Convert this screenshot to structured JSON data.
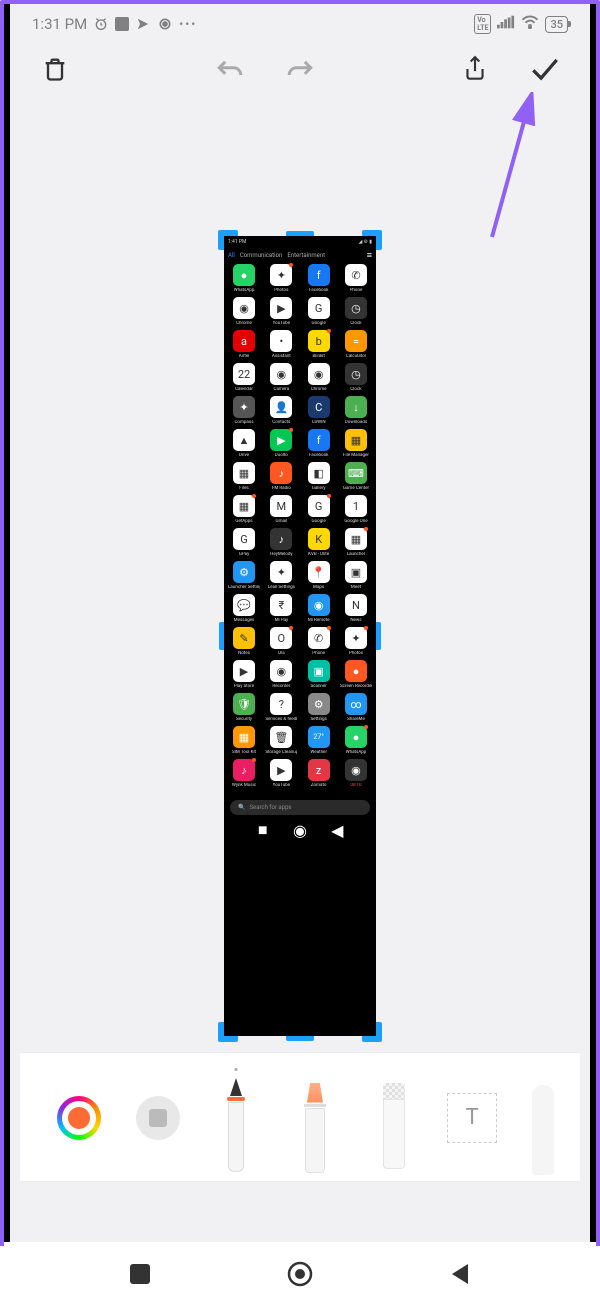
{
  "status": {
    "time": "1:31 PM",
    "battery": "35"
  },
  "toolbar": {
    "delete": "",
    "undo": "",
    "redo": "",
    "share": "",
    "confirm": ""
  },
  "phone": {
    "time": "1:41 PM",
    "tabs": [
      {
        "label": "All",
        "active": true
      },
      {
        "label": "Communication",
        "active": false
      },
      {
        "label": "Entertainment",
        "active": false
      }
    ],
    "search_placeholder": "Search for apps",
    "apps": [
      [
        {
          "n": "WhatsApp",
          "c": "#25d366",
          "i": "●",
          "d": false
        },
        {
          "n": "Photos",
          "c": "#fff",
          "i": "✦",
          "d": true
        },
        {
          "n": "Facebook",
          "c": "#1877f2",
          "i": "f",
          "d": false
        },
        {
          "n": "Phone",
          "c": "#fff",
          "i": "✆",
          "d": false
        }
      ],
      [
        {
          "n": "Chrome",
          "c": "#fff",
          "i": "◉",
          "d": false
        },
        {
          "n": "YouTube",
          "c": "#fff",
          "i": "▶",
          "d": false
        },
        {
          "n": "Google",
          "c": "#fff",
          "i": "G",
          "d": false
        },
        {
          "n": "Clock",
          "c": "#333",
          "i": "◷",
          "d": false
        }
      ],
      [
        {
          "n": "Airtel",
          "c": "#e40000",
          "i": "a",
          "d": false
        },
        {
          "n": "Assistant",
          "c": "#fff",
          "i": "•",
          "d": false
        },
        {
          "n": "Blinkit",
          "c": "#ffd800",
          "i": "b",
          "d": true
        },
        {
          "n": "Calculator",
          "c": "#ff9800",
          "i": "=",
          "d": false
        }
      ],
      [
        {
          "n": "Calendar",
          "c": "#fff",
          "i": "22",
          "d": false
        },
        {
          "n": "Camera",
          "c": "#fff",
          "i": "◉",
          "d": false
        },
        {
          "n": "Chrome",
          "c": "#fff",
          "i": "◉",
          "d": false
        },
        {
          "n": "Clock",
          "c": "#333",
          "i": "◷",
          "d": false
        }
      ],
      [
        {
          "n": "Compass",
          "c": "#555",
          "i": "✦",
          "d": false
        },
        {
          "n": "Contacts",
          "c": "#fff",
          "i": "👤",
          "d": false
        },
        {
          "n": "CoWIN",
          "c": "#1a3a6e",
          "i": "C",
          "d": false
        },
        {
          "n": "Downloads",
          "c": "#4caf50",
          "i": "↓",
          "d": false
        }
      ],
      [
        {
          "n": "Drive",
          "c": "#fff",
          "i": "▲",
          "d": false
        },
        {
          "n": "Duolto",
          "c": "#00c853",
          "i": "▶",
          "d": true
        },
        {
          "n": "Facebook",
          "c": "#1877f2",
          "i": "f",
          "d": false
        },
        {
          "n": "File Manager",
          "c": "#ffc107",
          "i": "▦",
          "d": false
        }
      ],
      [
        {
          "n": "Files",
          "c": "#fff",
          "i": "▦",
          "d": false
        },
        {
          "n": "FM Radio",
          "c": "#ff5722",
          "i": "♪",
          "d": false
        },
        {
          "n": "Gallery",
          "c": "#fff",
          "i": "◧",
          "d": false
        },
        {
          "n": "Game Center",
          "c": "#4caf50",
          "i": "⌨",
          "d": false
        }
      ],
      [
        {
          "n": "GetApps",
          "c": "#fff",
          "i": "▦",
          "d": true
        },
        {
          "n": "Gmail",
          "c": "#fff",
          "i": "M",
          "d": false
        },
        {
          "n": "Google",
          "c": "#fff",
          "i": "G",
          "d": true
        },
        {
          "n": "Google One",
          "c": "#fff",
          "i": "1",
          "d": false
        }
      ],
      [
        {
          "n": "GPay",
          "c": "#fff",
          "i": "G",
          "d": false
        },
        {
          "n": "HeyMelody",
          "c": "#333",
          "i": "♪",
          "d": false
        },
        {
          "n": "KVB - Dlite",
          "c": "#ffd800",
          "i": "K",
          "d": false
        },
        {
          "n": "Launcher",
          "c": "#fff",
          "i": "▦",
          "d": true
        }
      ],
      [
        {
          "n": "Launcher Settings",
          "c": "#2196f3",
          "i": "⚙",
          "d": false
        },
        {
          "n": "Lean Settings",
          "c": "#fff",
          "i": "✦",
          "d": false
        },
        {
          "n": "Maps",
          "c": "#fff",
          "i": "📍",
          "d": false
        },
        {
          "n": "Meet",
          "c": "#fff",
          "i": "▣",
          "d": false
        }
      ],
      [
        {
          "n": "Messages",
          "c": "#fff",
          "i": "💬",
          "d": false
        },
        {
          "n": "Mi Pay",
          "c": "#fff",
          "i": "₹",
          "d": false
        },
        {
          "n": "Mi Remote",
          "c": "#2196f3",
          "i": "◉",
          "d": false
        },
        {
          "n": "News",
          "c": "#fff",
          "i": "N",
          "d": false
        }
      ],
      [
        {
          "n": "Notes",
          "c": "#ffc107",
          "i": "✎",
          "d": false
        },
        {
          "n": "Ola",
          "c": "#fff",
          "i": "O",
          "d": true
        },
        {
          "n": "Phone",
          "c": "#fff",
          "i": "✆",
          "d": true
        },
        {
          "n": "Photos",
          "c": "#fff",
          "i": "✦",
          "d": true
        }
      ],
      [
        {
          "n": "Play Store",
          "c": "#fff",
          "i": "▶",
          "d": false
        },
        {
          "n": "Recorder",
          "c": "#fff",
          "i": "◉",
          "d": false
        },
        {
          "n": "Scanner",
          "c": "#00bfa5",
          "i": "▣",
          "d": false
        },
        {
          "n": "Screen Recorder",
          "c": "#ff5722",
          "i": "●",
          "d": false
        }
      ],
      [
        {
          "n": "Security",
          "c": "#4caf50",
          "i": "🛡",
          "d": false
        },
        {
          "n": "Services & feedback",
          "c": "#fff",
          "i": "?",
          "d": false
        },
        {
          "n": "Settings",
          "c": "#888",
          "i": "⚙",
          "d": false
        },
        {
          "n": "ShareMe",
          "c": "#2196f3",
          "i": "∞",
          "d": false
        }
      ],
      [
        {
          "n": "SIM Tool Kit",
          "c": "#ff9800",
          "i": "▦",
          "d": false
        },
        {
          "n": "Storage Cleanup",
          "c": "#fff",
          "i": "🗑",
          "d": false
        },
        {
          "n": "Weather",
          "c": "#2196f3",
          "i": "27°",
          "d": false
        },
        {
          "n": "WhatsApp",
          "c": "#25d366",
          "i": "●",
          "d": true
        }
      ],
      [
        {
          "n": "Wynk Music",
          "c": "#e91e63",
          "i": "♪",
          "d": true
        },
        {
          "n": "YouTube",
          "c": "#fff",
          "i": "▶",
          "d": false
        },
        {
          "n": "Zomato",
          "c": "#e23744",
          "i": "z",
          "d": false
        },
        {
          "n": "",
          "c": "#333",
          "i": "◉",
          "d": false,
          "rec": "00:10"
        }
      ]
    ]
  },
  "tools": {
    "text_label": "T"
  }
}
